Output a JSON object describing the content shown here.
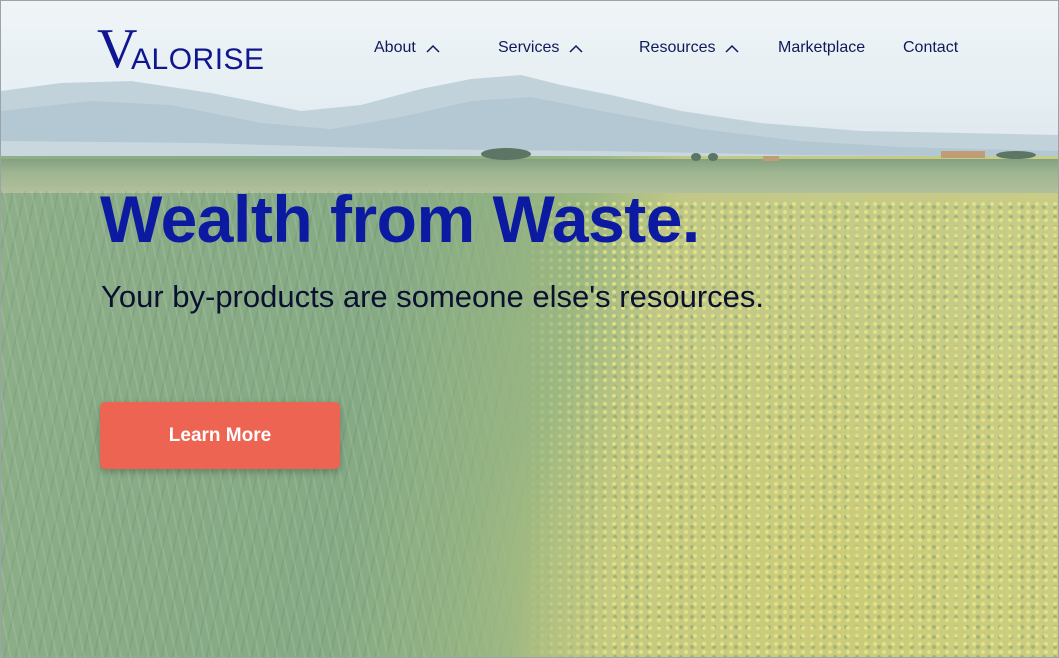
{
  "brand": {
    "logo_initial": "V",
    "logo_rest": "ALORISE"
  },
  "nav": {
    "items": [
      {
        "label": "About",
        "has_dropdown": true
      },
      {
        "label": "Services",
        "has_dropdown": true
      },
      {
        "label": "Resources",
        "has_dropdown": true
      },
      {
        "label": "Marketplace",
        "has_dropdown": false
      },
      {
        "label": "Contact",
        "has_dropdown": false
      }
    ]
  },
  "hero": {
    "headline": "Wealth from Waste.",
    "subheadline": "Your by-products are someone else's resources.",
    "cta_label": "Learn More"
  },
  "colors": {
    "brand_blue": "#0b1aa0",
    "nav_text": "#0e1a5c",
    "cta_background": "#ee6453",
    "cta_text": "#ffffff"
  },
  "icons": {
    "dropdown": "chevron-up-icon"
  }
}
